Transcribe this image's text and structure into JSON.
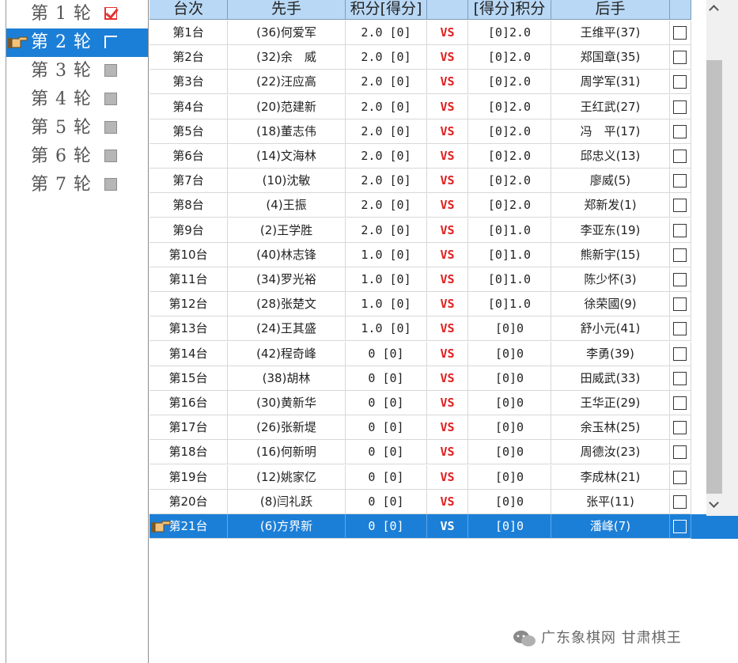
{
  "rounds": [
    {
      "label": "第 1 轮",
      "status": "done"
    },
    {
      "label": "第 2 轮",
      "status": "current"
    },
    {
      "label": "第 3 轮",
      "status": "pending"
    },
    {
      "label": "第 4 轮",
      "status": "pending"
    },
    {
      "label": "第 5 轮",
      "status": "pending"
    },
    {
      "label": "第 6 轮",
      "status": "pending"
    },
    {
      "label": "第 7 轮",
      "status": "pending"
    }
  ],
  "table": {
    "headers": {
      "board": "台次",
      "first": "先手",
      "first_score": "积分[得分]",
      "vs": "",
      "second_score": "[得分]积分",
      "second": "后手",
      "check": ""
    },
    "selected_board": "第21台",
    "rows": [
      {
        "board": "第1台",
        "first": "(36)何爱军",
        "first_score": "2.0 [0]",
        "vs": "VS",
        "second_score": "[0]2.0",
        "second": "王维平(37)"
      },
      {
        "board": "第2台",
        "first": "(32)余　威",
        "first_score": "2.0 [0]",
        "vs": "VS",
        "second_score": "[0]2.0",
        "second": "郑国章(35)"
      },
      {
        "board": "第3台",
        "first": "(22)汪应高",
        "first_score": "2.0 [0]",
        "vs": "VS",
        "second_score": "[0]2.0",
        "second": "周学军(31)"
      },
      {
        "board": "第4台",
        "first": "(20)范建新",
        "first_score": "2.0 [0]",
        "vs": "VS",
        "second_score": "[0]2.0",
        "second": "王红武(27)"
      },
      {
        "board": "第5台",
        "first": "(18)董志伟",
        "first_score": "2.0 [0]",
        "vs": "VS",
        "second_score": "[0]2.0",
        "second": "冯　平(17)"
      },
      {
        "board": "第6台",
        "first": "(14)文海林",
        "first_score": "2.0 [0]",
        "vs": "VS",
        "second_score": "[0]2.0",
        "second": "邱忠义(13)"
      },
      {
        "board": "第7台",
        "first": "(10)沈敏",
        "first_score": "2.0 [0]",
        "vs": "VS",
        "second_score": "[0]2.0",
        "second": "廖威(5)"
      },
      {
        "board": "第8台",
        "first": "(4)王振",
        "first_score": "2.0 [0]",
        "vs": "VS",
        "second_score": "[0]2.0",
        "second": "郑新发(1)"
      },
      {
        "board": "第9台",
        "first": "(2)王学胜",
        "first_score": "2.0 [0]",
        "vs": "VS",
        "second_score": "[0]1.0",
        "second": "李亚东(19)"
      },
      {
        "board": "第10台",
        "first": "(40)林志锋",
        "first_score": "1.0 [0]",
        "vs": "VS",
        "second_score": "[0]1.0",
        "second": "熊新宇(15)"
      },
      {
        "board": "第11台",
        "first": "(34)罗光裕",
        "first_score": "1.0 [0]",
        "vs": "VS",
        "second_score": "[0]1.0",
        "second": "陈少怀(3)"
      },
      {
        "board": "第12台",
        "first": "(28)张楚文",
        "first_score": "1.0 [0]",
        "vs": "VS",
        "second_score": "[0]1.0",
        "second": "徐荣國(9)"
      },
      {
        "board": "第13台",
        "first": "(24)王其盛",
        "first_score": "1.0 [0]",
        "vs": "VS",
        "second_score": "[0]0",
        "second": "舒小元(41)"
      },
      {
        "board": "第14台",
        "first": "(42)程奇峰",
        "first_score": "0 [0]",
        "vs": "VS",
        "second_score": "[0]0",
        "second": "李勇(39)"
      },
      {
        "board": "第15台",
        "first": "(38)胡林",
        "first_score": "0 [0]",
        "vs": "VS",
        "second_score": "[0]0",
        "second": "田威武(33)"
      },
      {
        "board": "第16台",
        "first": "(30)黄新华",
        "first_score": "0 [0]",
        "vs": "VS",
        "second_score": "[0]0",
        "second": "王华正(29)"
      },
      {
        "board": "第17台",
        "first": "(26)张新堤",
        "first_score": "0 [0]",
        "vs": "VS",
        "second_score": "[0]0",
        "second": "余玉林(25)"
      },
      {
        "board": "第18台",
        "first": "(16)何新明",
        "first_score": "0 [0]",
        "vs": "VS",
        "second_score": "[0]0",
        "second": "周德汝(23)"
      },
      {
        "board": "第19台",
        "first": "(12)姚家亿",
        "first_score": "0 [0]",
        "vs": "VS",
        "second_score": "[0]0",
        "second": "李成林(21)"
      },
      {
        "board": "第20台",
        "first": "(8)闫礼跃",
        "first_score": "0 [0]",
        "vs": "VS",
        "second_score": "[0]0",
        "second": "张平(11)"
      },
      {
        "board": "第21台",
        "first": "(6)方界新",
        "first_score": "0 [0]",
        "vs": "VS",
        "second_score": "[0]0",
        "second": "潘峰(7)"
      }
    ]
  },
  "watermark": {
    "text": "广东象棋网  甘肃棋王",
    "icon": "wechat-icon"
  },
  "colors": {
    "selection": "#1c7fd7",
    "header_bg": "#b9d8f5",
    "vs_red": "#e02020",
    "done_check": "#e53030"
  }
}
